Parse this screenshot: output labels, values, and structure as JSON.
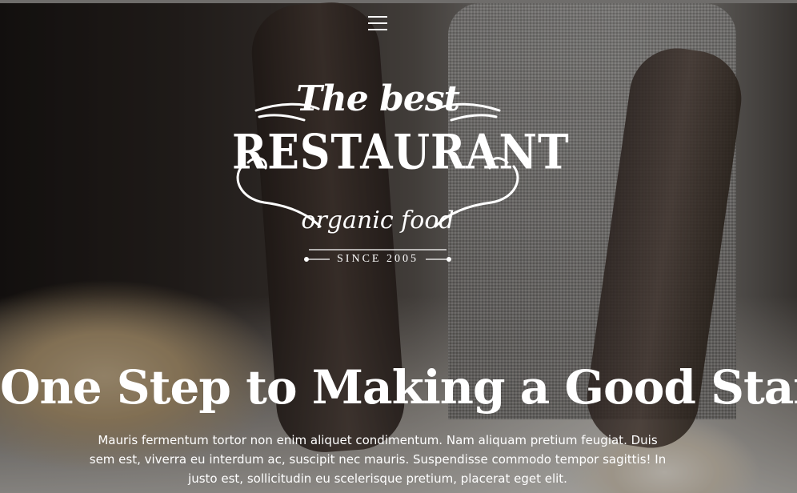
{
  "header": {
    "menu_icon": "hamburger-menu-icon"
  },
  "logo": {
    "top_text": "The best",
    "main_text": "RESTAURANT",
    "sub_text": "organic food",
    "since_text": "SINCE 2005"
  },
  "hero": {
    "headline": "One Step to Making a Good Start",
    "description": "Mauris fermentum tortor non enim aliquet condimentum. Nam aliquam pretium feugiat. Duis sem est, viverra eu interdum ac, suscipit nec mauris. Suspendisse commodo tempor sagittis! In justo est, sollicitudin eu scelerisque pretium, placerat eget elit."
  }
}
